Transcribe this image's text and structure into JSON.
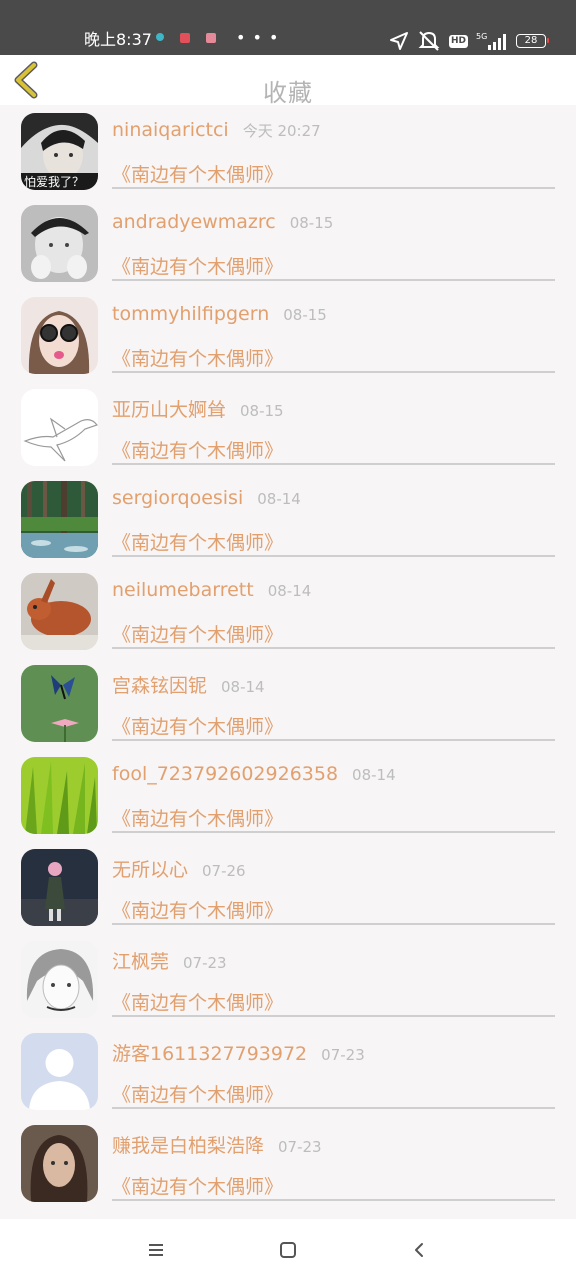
{
  "status_bar": {
    "time": "晚上8:37",
    "more": "• • •",
    "network": "5G",
    "hd": "HD",
    "battery": "28",
    "icons": [
      "wifi-dot-icon",
      "app-notif-icon",
      "message-notif-icon",
      "location-icon",
      "silent-icon",
      "hd-icon",
      "signal-icon",
      "battery-icon"
    ]
  },
  "header": {
    "title": "收藏",
    "back_icon": "chevron-left-icon"
  },
  "colors": {
    "accent": "#e2a06f",
    "date": "#bdbdbd",
    "title": "#b4b4b4",
    "back": "#c9b32e"
  },
  "favorites": [
    {
      "username": "ninaiqarictci",
      "date": "今天 20:27",
      "title": "《南边有个木偶师》",
      "avatar": "boy-portrait-dark",
      "avatar_caption": "怕爱我了？"
    },
    {
      "username": "andradyewmazrc",
      "date": "08-15",
      "title": "《南边有个木偶师》",
      "avatar": "boy-portrait-gray",
      "avatar_caption": ""
    },
    {
      "username": "tommyhilfipgern",
      "date": "08-15",
      "title": "《南边有个木偶师》",
      "avatar": "girl-sunglasses",
      "avatar_caption": ""
    },
    {
      "username": "亚历山大婀耸",
      "date": "08-15",
      "title": "《南边有个木偶师》",
      "avatar": "bird-sketch",
      "avatar_caption": ""
    },
    {
      "username": "sergiorqoesisi",
      "date": "08-14",
      "title": "《南边有个木偶师》",
      "avatar": "forest-river",
      "avatar_caption": ""
    },
    {
      "username": "neilumebarrett",
      "date": "08-14",
      "title": "《南边有个木偶师》",
      "avatar": "rabbit",
      "avatar_caption": ""
    },
    {
      "username": "宫森铉因铌",
      "date": "08-14",
      "title": "《南边有个木偶师》",
      "avatar": "butterfly-flower",
      "avatar_caption": ""
    },
    {
      "username": "fool_723792602926358",
      "date": "08-14",
      "title": "《南边有个木偶师》",
      "avatar": "green-grass",
      "avatar_caption": ""
    },
    {
      "username": "无所以心",
      "date": "07-26",
      "title": "《南边有个木偶师》",
      "avatar": "anime-girl-dark",
      "avatar_caption": ""
    },
    {
      "username": "江枫莞",
      "date": "07-23",
      "title": "《南边有个木偶师》",
      "avatar": "anime-girl-sketch",
      "avatar_caption": ""
    },
    {
      "username": "游客1611327793972",
      "date": "07-23",
      "title": "《南边有个木偶师》",
      "avatar": "default-user",
      "avatar_caption": ""
    },
    {
      "username": "赚我是白柏梨浩降",
      "date": "07-23",
      "title": "《南边有个木偶师》",
      "avatar": "girl-portrait-sepia",
      "avatar_caption": ""
    }
  ],
  "nav": {
    "icons": [
      "menu-icon",
      "home-icon",
      "back-icon"
    ]
  }
}
